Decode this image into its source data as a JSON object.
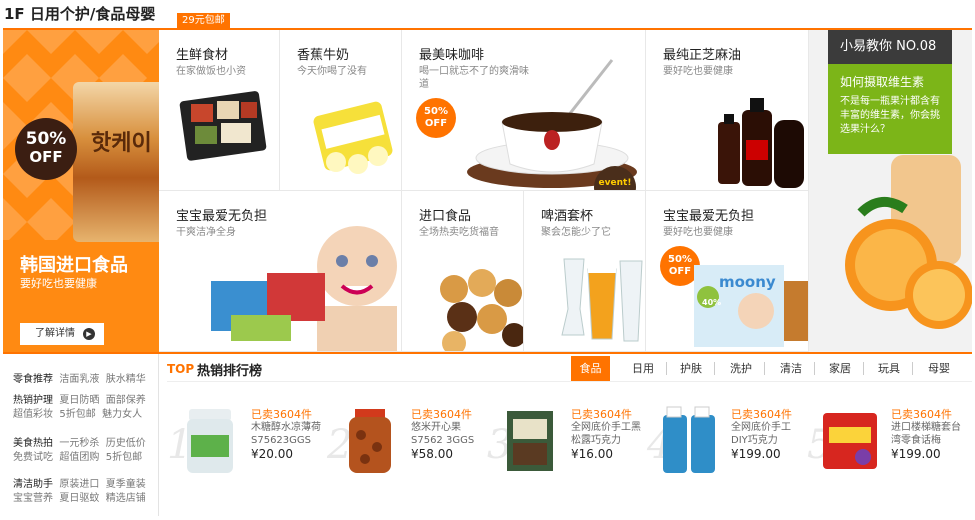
{
  "header": {
    "floor_title": "1F 日用个护/食品母婴",
    "shipping_badge": "29元包邮"
  },
  "banner": {
    "badge_pct": "50%",
    "badge_off": "OFF",
    "product_label": "핫케이",
    "title": "韩国进口食品",
    "subtitle": "要好吃也要健康",
    "button_label": "了解详情"
  },
  "grid": [
    {
      "title": "生鲜食材",
      "sub": "在家做饭也小资"
    },
    {
      "title": "香蕉牛奶",
      "sub": "今天你喝了没有"
    },
    {
      "title": "最美味咖啡",
      "sub": "喝一口就忘不了的爽滑味道",
      "badge": "50%\nOFF",
      "tag": "event!"
    },
    {
      "title": "最纯正芝麻油",
      "sub": "要好吃也要健康"
    },
    {
      "title": "宝宝最爱无负担",
      "sub": "干爽洁净全身"
    },
    {
      "title": "进口食品",
      "sub": "全场热卖吃货福音"
    },
    {
      "title": "啤酒套杯",
      "sub": "聚会怎能少了它"
    },
    {
      "title": "宝宝最爱无负担",
      "sub": "要好吃也要健康",
      "badge": "50%\nOFF",
      "brand": "moony",
      "promo": "40%"
    }
  ],
  "tip": {
    "header": "小易教你 NO.08",
    "title": "如何摄取维生素",
    "text": "不是每一瓶果汁都含有丰富的维生素，你会挑选果汁么？"
  },
  "links": [
    {
      "cat": "零食推荐",
      "items": [
        "洁面乳液",
        "肤水精华"
      ]
    },
    {
      "cat": "热销护理",
      "items": [
        "夏日防晒",
        "面部保养"
      ]
    },
    {
      "cat": "",
      "items": [
        "超值彩妆",
        "5折包邮",
        "魅力女人"
      ]
    },
    {
      "cat": "美食热拍",
      "items": [
        "一元秒杀",
        "历史低价"
      ]
    },
    {
      "cat": "",
      "items": [
        "免费试吃",
        "超值团购",
        "5折包邮"
      ]
    },
    {
      "cat": "清洁助手",
      "items": [
        "原装进口",
        "夏季童装"
      ]
    },
    {
      "cat": "",
      "items": [
        "宝宝营养",
        "夏日驱蚊",
        "精选店铺"
      ]
    }
  ],
  "ranking": {
    "top_label": "TOP",
    "title": "热销排行榜",
    "tabs": [
      "食品",
      "日用",
      "护肤",
      "洗护",
      "清洁",
      "家居",
      "玩具",
      "母婴"
    ],
    "items": [
      {
        "rank": "1",
        "sold": "已卖3604件",
        "name": "木糖醇水凉薄荷S75623GGS",
        "price": "¥20.00"
      },
      {
        "rank": "2",
        "sold": "已卖3604件",
        "name": "悠米开心果S7562 3GGS",
        "price": "¥58.00"
      },
      {
        "rank": "3",
        "sold": "已卖3604件",
        "name": "全网底价手工黑松露巧克力",
        "price": "¥16.00"
      },
      {
        "rank": "4",
        "sold": "已卖3604件",
        "name": "全网底价手工DIY巧克力",
        "price": "¥199.00"
      },
      {
        "rank": "5",
        "sold": "已卖3604件",
        "name": "进口楼梯糖套台湾零食话梅",
        "price": "¥199.00"
      }
    ]
  },
  "colors": {
    "accent": "#ff7300",
    "tip_green": "#7cb518",
    "dark": "#3b3b3b"
  }
}
